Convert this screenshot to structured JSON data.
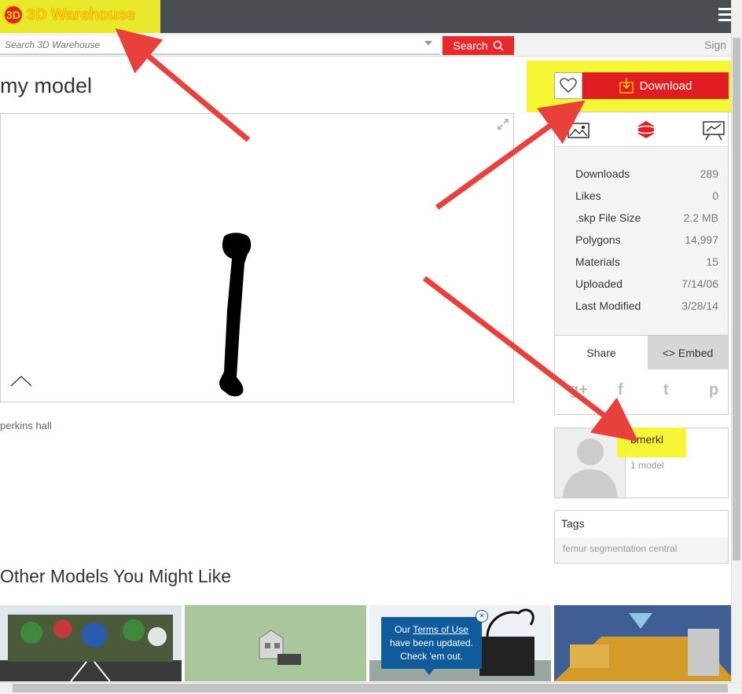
{
  "header": {
    "logo_text": "3D Warehouse",
    "logo_mark": "3D",
    "menu_icon": "hamburger-icon"
  },
  "search": {
    "placeholder": "Search 3D Warehouse",
    "button_label": "Search",
    "sign_label": "Sign"
  },
  "model": {
    "title": "my model",
    "description": "perkins hall"
  },
  "actions": {
    "download_label": "Download",
    "like_icon": "heart-icon"
  },
  "stats": [
    {
      "label": "Downloads",
      "value": "289"
    },
    {
      "label": "Likes",
      "value": "0"
    },
    {
      "label": ".skp File Size",
      "value": "2.2 MB"
    },
    {
      "label": "Polygons",
      "value": "14,997"
    },
    {
      "label": "Materials",
      "value": "15"
    },
    {
      "label": "Uploaded",
      "value": "7/14/06"
    },
    {
      "label": "Last Modified",
      "value": "3/28/14"
    }
  ],
  "share": {
    "share_label": "Share",
    "embed_label": "<> Embed",
    "social": [
      "g+",
      "f",
      "t",
      "p"
    ]
  },
  "author": {
    "name": "bmerkl",
    "models": "1 model"
  },
  "tags": {
    "title": "Tags",
    "items": "femur segmentation central"
  },
  "other": {
    "title": "Other Models You Might Like"
  },
  "notice": {
    "line1_prefix": "Our ",
    "link": "Terms of Use",
    "line2": "have been updated.",
    "line3": "Check 'em out.",
    "close": "×"
  },
  "colors": {
    "brand_red": "#e01e22",
    "highlight_yellow": "#f5f52a",
    "annotation_arrow": "#e8403a",
    "topbar": "#4a4d52"
  }
}
